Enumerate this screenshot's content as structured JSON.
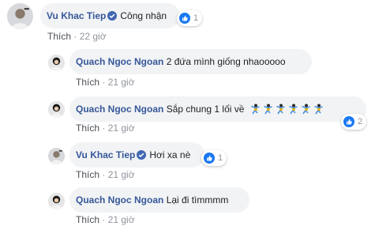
{
  "comments": [
    {
      "author": "Vu Khac Tiep",
      "verified": true,
      "text": "Công nhận",
      "like_label": "Thích",
      "time": "22 giờ",
      "reaction_count": "1"
    },
    {
      "author": "Quach Ngoc Ngoan",
      "verified": false,
      "text": "2 đứa mình giống nhaooooo",
      "like_label": "Thích",
      "time": "21 giờ"
    },
    {
      "author": "Quach Ngoc Ngoan",
      "verified": false,
      "text": "Sắp chung 1 lối về",
      "emoji": "dancer-emoji",
      "emoji_count": 6,
      "like_label": "Thích",
      "time": "21 giờ",
      "reaction_count": "2"
    },
    {
      "author": "Vu Khac Tiep",
      "verified": true,
      "text": "Hơi xa nè",
      "like_label": "Thích",
      "time": "21 giờ",
      "reaction_count": "1"
    },
    {
      "author": "Quach Ngoc Ngoan",
      "verified": false,
      "text": "Lại đi tìmmmm",
      "like_label": "Thích",
      "time": "21 giờ"
    }
  ],
  "separator": "·",
  "colors": {
    "author": "#365899",
    "bubble": "#f2f3f5",
    "meta": "#90949c",
    "like_badge": "#1877f2"
  },
  "icons": {
    "verified": "verified-badge-icon",
    "reaction": "like-reaction-icon"
  }
}
